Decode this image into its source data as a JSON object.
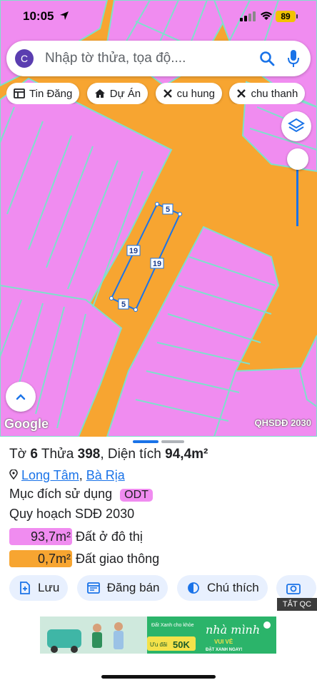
{
  "status": {
    "time": "10:05",
    "battery": "89"
  },
  "search": {
    "avatar": "C",
    "placeholder": "Nhập tờ thửa, tọa độ...."
  },
  "chips": [
    {
      "label": "Tin Đăng",
      "icon": "list-icon"
    },
    {
      "label": "Dự Án",
      "icon": "house-icon"
    },
    {
      "label": "cu hung",
      "icon": "tools-icon"
    },
    {
      "label": "chu thanh",
      "icon": "tools-icon"
    }
  ],
  "map": {
    "attribution": "Google",
    "layer_name": "QHSDĐ 2030",
    "parcel_edges": {
      "top": "5",
      "left": "19",
      "right": "19",
      "bottom": "5"
    },
    "colors": {
      "residential": "#f08cf0",
      "road": "#f7a531",
      "parcel_outline": "#1a73e8",
      "lot_lines": "#7fe0cc"
    }
  },
  "parcel": {
    "to_label": "Tờ",
    "to": "6",
    "thua_label": "Thửa",
    "thua": "398",
    "area_label": "Diện tích",
    "area": "94,4m²",
    "ward": "Long Tâm",
    "city": "Bà Rịa",
    "purpose_label": "Mục đích sử dụng",
    "purpose": "ODT",
    "planning_label": "Quy hoạch SDĐ 2030",
    "zones": [
      {
        "area": "93,7m²",
        "label": "Đất ở đô thị",
        "color": "#f08cf0"
      },
      {
        "area": "0,7m²",
        "label": "Đất giao thông",
        "color": "#f7a531"
      }
    ]
  },
  "actions": [
    {
      "label": "Lưu",
      "icon": "save-icon"
    },
    {
      "label": "Đăng bán",
      "icon": "listing-icon"
    },
    {
      "label": "Chú thích",
      "icon": "legend-icon"
    }
  ],
  "ad": {
    "badge": "TẮT QC",
    "headline": "nhà mình",
    "subline": "VUI VẺ",
    "tagline": "Đất Xanh cho khỏe",
    "promo": "50K",
    "promo_prefix": "Ưu đãi",
    "cta": "ĐẶT XANH NGAY!"
  }
}
